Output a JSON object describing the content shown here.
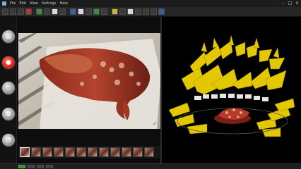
{
  "menu": {
    "items": [
      "File",
      "Edit",
      "View",
      "Settings",
      "Help"
    ]
  },
  "window_controls": {
    "minimize": "–",
    "maximize": "□",
    "close": "×"
  },
  "toolbar": {
    "buttons": [
      "new-icon",
      "open-icon",
      "save-icon",
      "brush-icon",
      "select-icon",
      "crop-icon",
      "eraser-icon",
      "pen-icon",
      "camera-icon",
      "cloud-icon",
      "mesh-icon",
      "grid-icon",
      "image-icon",
      "play-icon",
      "settings-icon",
      "export-icon",
      "chart-icon",
      "plus-icon",
      "minus-icon",
      "wand-icon"
    ]
  },
  "sidebar": {
    "buttons": [
      {
        "name": "photos-button",
        "glyph": "▤"
      },
      {
        "name": "align-button",
        "glyph": "●"
      },
      {
        "name": "reconstruct-button",
        "glyph": "◌"
      },
      {
        "name": "mesh-button",
        "glyph": "◍"
      },
      {
        "name": "texture-button",
        "glyph": "◔"
      }
    ]
  },
  "filmstrip": {
    "thumbnail_count": 12,
    "selected_index": 0
  },
  "colors": {
    "background": "#0b0b0b",
    "camera_planes": "#e3c700",
    "object_red": "#b83a2a",
    "accent_green": "#36d24b"
  },
  "status": {
    "text": ""
  },
  "icons": {
    "check": "✔"
  }
}
